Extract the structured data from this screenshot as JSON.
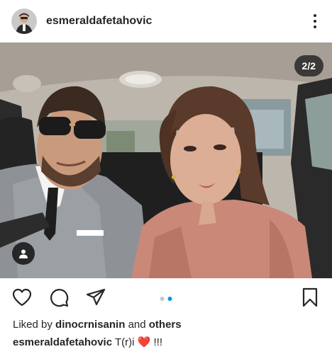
{
  "post": {
    "username": "esmeraldafetahovic",
    "image_counter": "2/2",
    "carousel": {
      "total": 2,
      "active": 2
    }
  },
  "icons": {
    "more": "more-vertical-icon",
    "like": "heart-outline-icon",
    "comment": "comment-bubble-icon",
    "share": "paper-plane-icon",
    "save": "bookmark-outline-icon",
    "tagged": "person-tag-icon"
  },
  "likes": {
    "prefix": "Liked by",
    "user": "dinocrnisanin",
    "conjunction": "and",
    "others": "others"
  },
  "caption": {
    "username": "esmeraldafetahovic",
    "text": "T(r)i",
    "emoji": "❤️",
    "suffix": "!!!"
  },
  "colors": {
    "accent": "#0095f6",
    "text": "#262626",
    "heart": "#e0245e"
  }
}
